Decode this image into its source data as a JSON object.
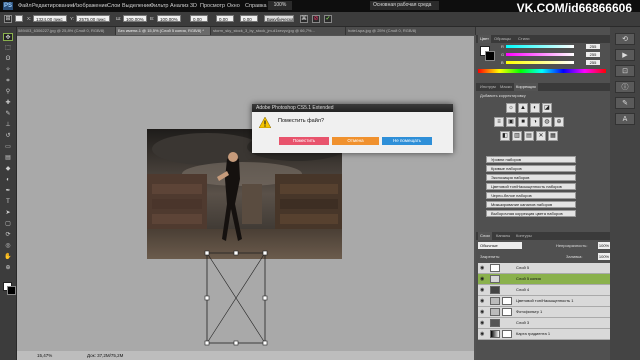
{
  "watermark": "VK.COM/id66866606",
  "menubar": {
    "logo": "PS",
    "items": [
      "Файл",
      "Редактирование",
      "Изображение",
      "Слои",
      "Выделение",
      "Фильтр",
      "Анализ",
      "3D",
      "Просмотр",
      "Окно",
      "Справка"
    ],
    "zoom": "100%",
    "workspace": "Основная рабочая среда"
  },
  "options": {
    "x": "1324,00 пикс",
    "y": "2575,00 пикс",
    "w": "100,00%",
    "h": "100,00%",
    "angle": "0,00",
    "hskew": "0,00",
    "vskew": "0,00",
    "interp": "Бикубическая"
  },
  "tabs": [
    {
      "label": "589403_6306227.jpg @ 25,8% (Слой 0, RGB/8)",
      "active": false
    },
    {
      "label": "Без имени-1 @ 15,5% (Слой 5 копия, RGB/8) *",
      "active": true
    },
    {
      "label": "storm_sky_stock_3_by_stock_jm-d1xevyv.jpg @ 66,7%...",
      "active": false
    },
    {
      "label": "hotel-spa.jpg @ 25% (Слой 0, RGB/8)",
      "active": false
    }
  ],
  "tools": [
    "move",
    "marquee",
    "lasso",
    "quick-select",
    "crop",
    "eyedropper",
    "healing",
    "brush",
    "stamp",
    "history-brush",
    "eraser",
    "gradient",
    "blur",
    "dodge",
    "pen",
    "type",
    "path-select",
    "shape",
    "3d-rotate",
    "3d-orbit",
    "hand",
    "zoom"
  ],
  "status": {
    "zoom": "15,47%",
    "doc": "Док: 37,2М/75,2М"
  },
  "dialog": {
    "title": "Adobe Photoshop CS5.1 Extended",
    "message": "Поместить файл?",
    "buttons": [
      {
        "label": "Поместить",
        "color": "#e8536c"
      },
      {
        "label": "Отмена",
        "color": "#f0912e"
      },
      {
        "label": "Не помещать",
        "color": "#2e8fd8"
      }
    ]
  },
  "color_panel": {
    "tabs": [
      "Цвет",
      "Образцы",
      "Стили"
    ],
    "channels": [
      {
        "label": "R",
        "value": "255"
      },
      {
        "label": "G",
        "value": "255"
      },
      {
        "label": "B",
        "value": "255"
      }
    ]
  },
  "adjust_panel": {
    "tabs": [
      "Инструм",
      "Маски",
      "Коррекция"
    ],
    "heading": "Добавить корректировку",
    "icons_row1": [
      "☼",
      "▲",
      "◐",
      "◪"
    ],
    "icons_row2": [
      "≡",
      "▣",
      "■",
      "◑",
      "◍",
      "⊕"
    ],
    "icons_row3": [
      "◧",
      "▥",
      "▤",
      "✕",
      "▦"
    ],
    "presets": [
      "Уровни наборов",
      "Кривые наборов",
      "Экспозиция наборов",
      "Цветовой тон/Насыщенность наборов",
      "Черно-белое наборов",
      "Микширование каналов наборов",
      "Выборочная коррекция цвета наборов"
    ]
  },
  "layers_panel": {
    "tabs": [
      "Слои",
      "Каналы",
      "Контуры"
    ],
    "blend": "Обычные",
    "opacity_label": "Непрозрачность:",
    "opacity": "100%",
    "fill_label": "Заливка:",
    "fill": "100%",
    "lock_label": "Закрепить:",
    "layers": [
      {
        "name": "Слой 5",
        "selected": false,
        "mask": false
      },
      {
        "name": "Слой 5 копия",
        "selected": true,
        "mask": false
      },
      {
        "name": "Слой 4",
        "selected": false,
        "mask": false
      },
      {
        "name": "Цветовой тон/Насыщенность 1",
        "selected": false,
        "mask": true
      },
      {
        "name": "Фотофильтр 1",
        "selected": false,
        "mask": true
      },
      {
        "name": "Слой 3",
        "selected": false,
        "mask": false
      },
      {
        "name": "Карта градиента 1",
        "selected": false,
        "mask": true
      }
    ]
  }
}
